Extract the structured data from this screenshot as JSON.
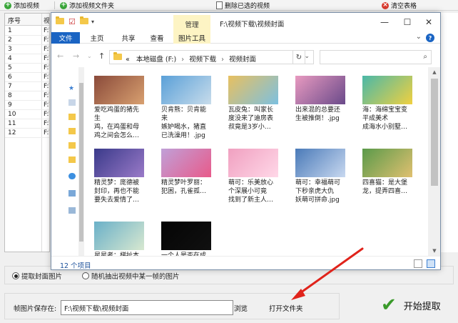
{
  "toolbar": {
    "add_video": "添加视频",
    "add_folder": "添加视频文件夹",
    "delete_selected": "删除已选的视频",
    "clear_table": "清空表格"
  },
  "grid": {
    "col_index": "序号",
    "col_video": "视",
    "rows": [
      {
        "index": "1",
        "path": "F:\\"
      },
      {
        "index": "2",
        "path": "F:\\"
      },
      {
        "index": "3",
        "path": "F:\\"
      },
      {
        "index": "4",
        "path": "F:\\"
      },
      {
        "index": "5",
        "path": "F:\\"
      },
      {
        "index": "6",
        "path": "F:\\"
      },
      {
        "index": "7",
        "path": "F:\\"
      },
      {
        "index": "8",
        "path": "F:\\"
      },
      {
        "index": "9",
        "path": "F:\\"
      },
      {
        "index": "10",
        "path": "F:\\"
      },
      {
        "index": "11",
        "path": "F:\\"
      },
      {
        "index": "12",
        "path": "F:\\"
      }
    ]
  },
  "explorer": {
    "manage_tab": "管理",
    "title": "F:\\视频下载\\视频封面",
    "ribbon_tabs": [
      "文件",
      "主页",
      "共享",
      "查看",
      "图片工具"
    ],
    "breadcrumb": [
      "«",
      "本地磁盘 (F:)",
      "视频下载",
      "视频封面"
    ],
    "status": "12 个项目",
    "files": [
      {
        "line1": "爱吃鸡蛋的猪先",
        "line2": "生",
        "line3": "鸡，在鸡蛋和母",
        "line4": "鸡之间会怎么…",
        "colors": [
          "#8a4a3a",
          "#d8a070"
        ]
      },
      {
        "line1": "贝肯熊：贝肯能",
        "line2": "来",
        "line3": "嫉妒喝水，猪直",
        "line4": "已洗澡用！.jpg",
        "colors": [
          "#5aa0d8",
          "#c8dceb"
        ]
      },
      {
        "line1": "瓦皮兔：叫家长",
        "line2": "",
        "line3": "度没来了迪房表",
        "line4": "叔竟是3岁小…",
        "colors": [
          "#e8c060",
          "#7cc0e0"
        ]
      },
      {
        "line1": "出来混的总要还",
        "line2": "",
        "line3": "生被推倒！.jpg",
        "line4": "",
        "colors": [
          "#e89ac0",
          "#6a4a8a"
        ]
      },
      {
        "line1": "海：海绵宝宝变",
        "line2": "",
        "line3": "平成美术",
        "line4": "成海水小别墅…",
        "colors": [
          "#4ab8a8",
          "#f0d040"
        ]
      },
      {
        "line1": "精灵梦：庞德被",
        "line2": "封印，再也不能",
        "line3": "",
        "line4": "要失去爱情了…",
        "colors": [
          "#3a3a8a",
          "#9a7ac8"
        ]
      },
      {
        "line1": "精灵梦叶罗丽：",
        "line2": "",
        "line3": "犯困，孔雀孤…",
        "line4": "",
        "colors": [
          "#c0a0d8",
          "#e85a8a"
        ]
      },
      {
        "line1": "萌可：乐美放心",
        "line2": "",
        "line3": "个深展小可竟",
        "line4": "找到了新主人…",
        "colors": [
          "#f0a0c0",
          "#ffd8e8"
        ]
      },
      {
        "line1": "萌可：幸福萌可",
        "line2": "",
        "line3": "下秒亲虎大仇",
        "line4": "妖萌可拼命.jpg",
        "colors": [
          "#4a7ab8",
          "#c8d8f0"
        ]
      },
      {
        "line1": "四喜猫：是大堡",
        "line2": "",
        "line3": "龙，提弄四喜…",
        "line4": "",
        "colors": [
          "#5a9a4a",
          "#e0c070"
        ]
      },
      {
        "line1": "星星者：梯扯本",
        "line2": "",
        "line3": "",
        "line4": "",
        "colors": [
          "#6ab0c8",
          "#d8e8d0"
        ]
      },
      {
        "line1": "一个人是否在成",
        "line2": "",
        "line3": "",
        "line4": "",
        "colors": [
          "#050505",
          "#101010"
        ]
      }
    ]
  },
  "options": {
    "radio1": "提取封面图片",
    "radio2": "随机抽出视频中某一帧的图片"
  },
  "save": {
    "label": "帧图片保存在:",
    "path": "F:\\视频下载\\视频封面",
    "browse": "浏览",
    "open_folder": "打开文件夹"
  },
  "start_label": "开始提取",
  "colors": {
    "file_tab": "#1a64c3",
    "manage_tab": "#fdf4c4",
    "arrow": "#e0231b",
    "start_check": "#3a9a2a"
  }
}
